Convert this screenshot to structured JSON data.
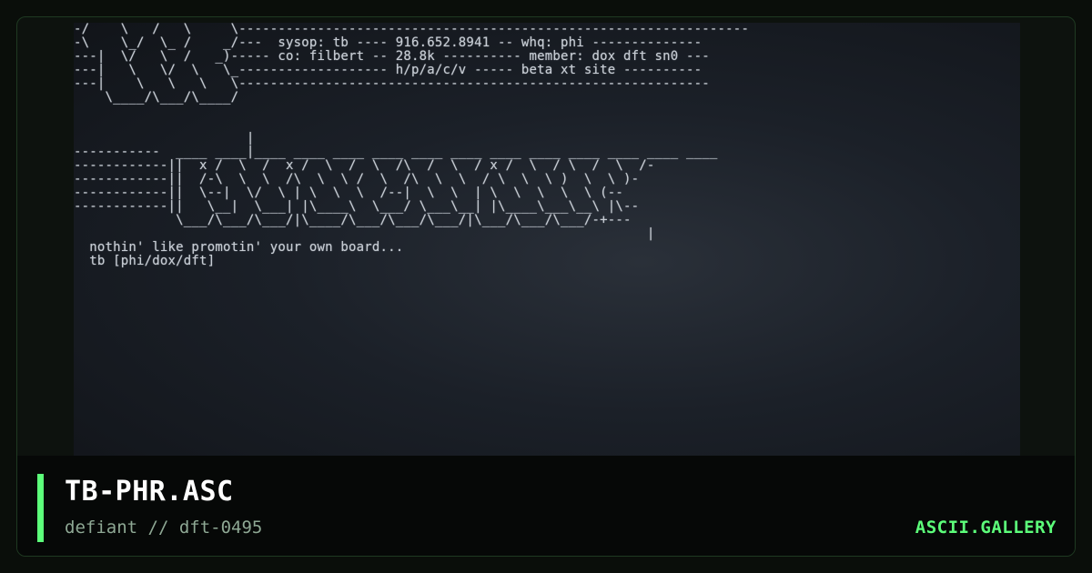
{
  "artwork": {
    "lines": [
      "-/    \\   /   \\     \\-----------------------------------------------------------------",
      "-\\    \\_/  \\_ /    _/---  sysop: tb ---- 916.652.8941 -- whq: phi --------------",
      "---|  \\/   \\  /   _)----- co: filbert -- 28.8k ---------- member: dox dft sn0 ---",
      "---|   \\   \\/  \\   \\_------------------- h/p/a/c/v ----- beta xt site ----------",
      "---|    \\   \\   \\   \\------------------------------------------------------------",
      "    \\____/\\___/\\____/",
      "",
      "",
      "                      |",
      "-----------  ____ ____|____ ____ ____ ____ ____ ____ ____ ____ ____ ____ ____ ____",
      "------------||  x /  \\  /  x /  \\  /  \\  /\\  /  \\  / x /  \\  / \\  /  \\  /-",
      "------------||  /-\\  \\  \\  /\\  \\  \\ /  \\  /\\  \\  \\  / \\  \\  \\ )  \\  \\ )-",
      "------------||  \\--|  \\/  \\ | \\  \\  \\  /--|  \\  \\  | \\  \\  \\  \\  \\ (--",
      "------------||   \\__|  \\___| |\\____\\  \\___/ \\___\\__| |\\____\\___\\__\\ |\\--",
      "             \\___/\\___/\\___/|\\____/\\___/\\___/\\___/|\\___/\\___/\\___/-+---",
      "                                                                         |",
      "  nothin' like promotin' your own board...",
      "  tb [phi/dox/dft]"
    ]
  },
  "caption": {
    "title": "TB-PHR.ASC",
    "subtitle": "defiant // dft-0495",
    "brand": "ASCII.GALLERY"
  },
  "colors": {
    "accent": "#5cff7a",
    "page_background": "#0a0e0a",
    "art_text": "#c7ccd3"
  }
}
